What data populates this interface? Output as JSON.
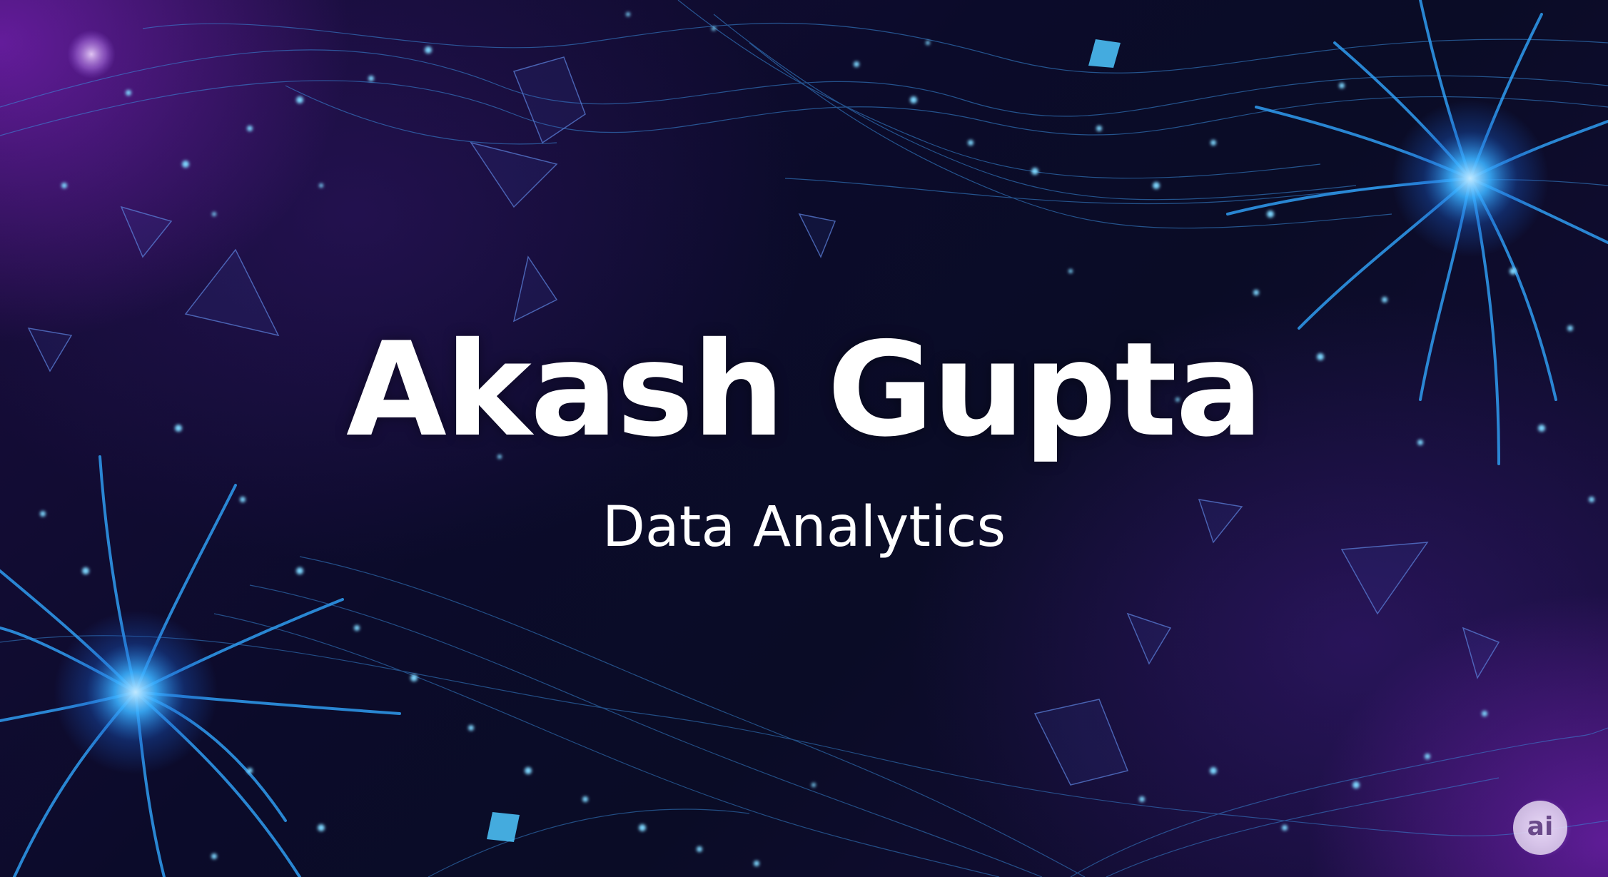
{
  "title": "Akash Gupta",
  "subtitle": "Data Analytics",
  "logo_text": "ai",
  "colors": {
    "background": "#0b0b2a",
    "neuron_glow": "#2aa8ff",
    "purple_glow": "#a028e6",
    "text": "#ffffff"
  }
}
